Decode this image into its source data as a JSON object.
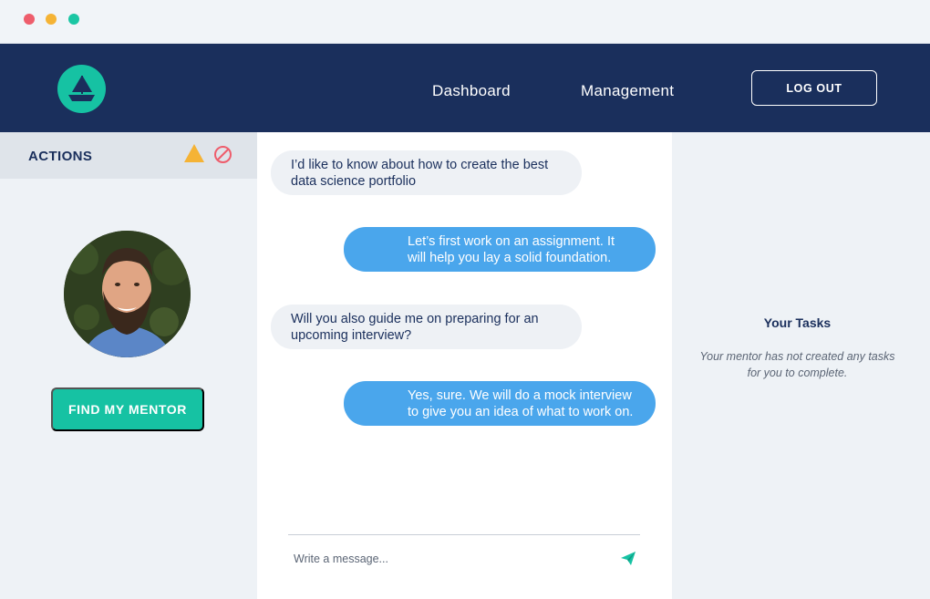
{
  "window": {
    "controls": [
      "close",
      "minimize",
      "maximize"
    ]
  },
  "navbar": {
    "logo_icon": "sailboat-logo-icon",
    "links": [
      {
        "label": "Dashboard"
      },
      {
        "label": "Management"
      }
    ],
    "logout_label": "LOG OUT"
  },
  "sidebar": {
    "title": "ACTIONS",
    "icons": [
      "warning-icon",
      "block-icon"
    ],
    "avatar": "mentor-avatar",
    "find_mentor_label": "FIND MY MENTOR"
  },
  "chat": {
    "messages": [
      {
        "direction": "incoming",
        "text": "I’d like to know about how to create the best data science portfolio"
      },
      {
        "direction": "outgoing",
        "text": "Let’s first work on an assignment. It will help you lay a solid foundation."
      },
      {
        "direction": "incoming",
        "text": "Will you also guide me on preparing for an upcoming interview?"
      },
      {
        "direction": "outgoing",
        "text": "Yes, sure. We will do a mock interview to give you an idea of what to work on."
      }
    ],
    "composer": {
      "placeholder": "Write a message...",
      "value": ""
    }
  },
  "tasks": {
    "title": "Your Tasks",
    "empty_message": "Your mentor has not created any tasks for you to complete."
  },
  "colors": {
    "navy": "#1a2f5c",
    "teal": "#16c2a3",
    "blue_bubble": "#4aa6ec",
    "gray_bubble": "#eef1f5",
    "warning": "#f5b335",
    "danger": "#ee5d6c"
  }
}
